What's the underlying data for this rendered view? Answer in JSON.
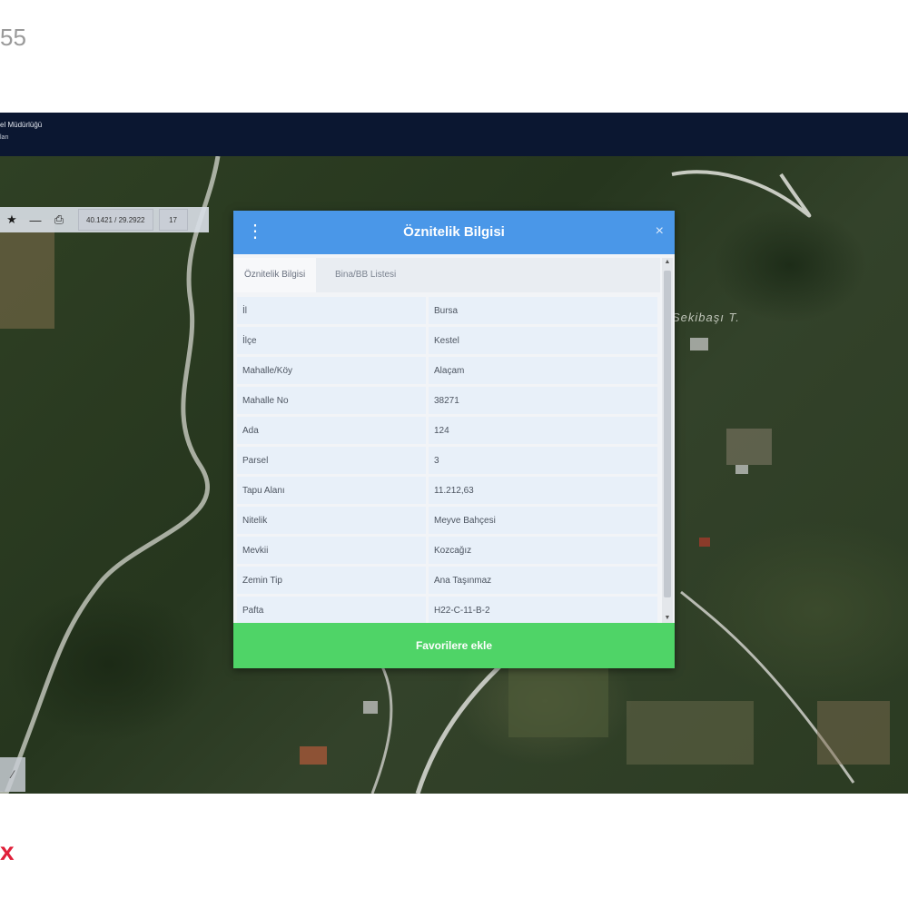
{
  "corner": {
    "top_left_number": "55",
    "bottom_left_mark": "x"
  },
  "app": {
    "header_line1": "el Müdürlüğü",
    "header_line2": "ları"
  },
  "toolbar": {
    "star_icon": "star-icon",
    "minus_icon": "minus-icon",
    "print_icon": "printer-icon",
    "coordinates": "40.1421 / 29.2922",
    "zoom_level": "17"
  },
  "map": {
    "place_label": "Sekibaşı T."
  },
  "dialog": {
    "title": "Öznitelik Bilgisi",
    "close_symbol": "×",
    "tabs": [
      {
        "label": "Öznitelik Bilgisi",
        "active": true
      },
      {
        "label": "Bina/BB Listesi",
        "active": false
      }
    ],
    "rows": [
      {
        "key": "İl",
        "value": "Bursa"
      },
      {
        "key": "İlçe",
        "value": "Kestel"
      },
      {
        "key": "Mahalle/Köy",
        "value": "Alaçam"
      },
      {
        "key": "Mahalle No",
        "value": "38271"
      },
      {
        "key": "Ada",
        "value": "124"
      },
      {
        "key": "Parsel",
        "value": "3"
      },
      {
        "key": "Tapu Alanı",
        "value": "11.212,63"
      },
      {
        "key": "Nitelik",
        "value": "Meyve Bahçesi"
      },
      {
        "key": "Mevkii",
        "value": "Kozcağız"
      },
      {
        "key": "Zemin Tip",
        "value": "Ana Taşınmaz"
      },
      {
        "key": "Pafta",
        "value": "H22-C-11-B-2"
      }
    ],
    "favorite_button": "Favorilere ekle"
  },
  "colors": {
    "header_bg": "#0b1731",
    "dialog_header": "#4a97e8",
    "favorite_button": "#4fd467"
  }
}
